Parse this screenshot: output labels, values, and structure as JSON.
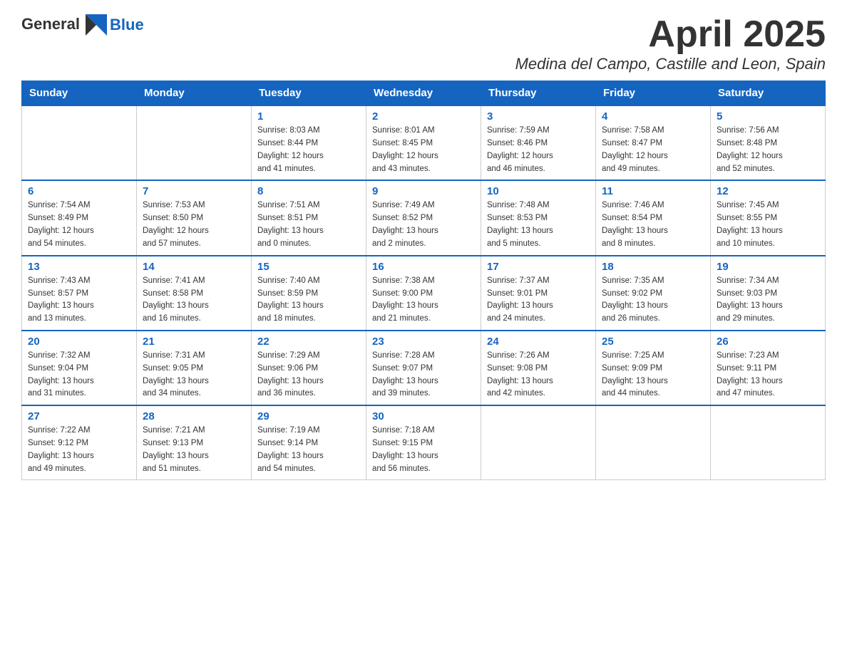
{
  "logo": {
    "text_general": "General",
    "text_blue": "Blue"
  },
  "header": {
    "month_year": "April 2025",
    "location": "Medina del Campo, Castille and Leon, Spain"
  },
  "weekdays": [
    "Sunday",
    "Monday",
    "Tuesday",
    "Wednesday",
    "Thursday",
    "Friday",
    "Saturday"
  ],
  "weeks": [
    [
      {
        "day": "",
        "info": ""
      },
      {
        "day": "",
        "info": ""
      },
      {
        "day": "1",
        "info": "Sunrise: 8:03 AM\nSunset: 8:44 PM\nDaylight: 12 hours\nand 41 minutes."
      },
      {
        "day": "2",
        "info": "Sunrise: 8:01 AM\nSunset: 8:45 PM\nDaylight: 12 hours\nand 43 minutes."
      },
      {
        "day": "3",
        "info": "Sunrise: 7:59 AM\nSunset: 8:46 PM\nDaylight: 12 hours\nand 46 minutes."
      },
      {
        "day": "4",
        "info": "Sunrise: 7:58 AM\nSunset: 8:47 PM\nDaylight: 12 hours\nand 49 minutes."
      },
      {
        "day": "5",
        "info": "Sunrise: 7:56 AM\nSunset: 8:48 PM\nDaylight: 12 hours\nand 52 minutes."
      }
    ],
    [
      {
        "day": "6",
        "info": "Sunrise: 7:54 AM\nSunset: 8:49 PM\nDaylight: 12 hours\nand 54 minutes."
      },
      {
        "day": "7",
        "info": "Sunrise: 7:53 AM\nSunset: 8:50 PM\nDaylight: 12 hours\nand 57 minutes."
      },
      {
        "day": "8",
        "info": "Sunrise: 7:51 AM\nSunset: 8:51 PM\nDaylight: 13 hours\nand 0 minutes."
      },
      {
        "day": "9",
        "info": "Sunrise: 7:49 AM\nSunset: 8:52 PM\nDaylight: 13 hours\nand 2 minutes."
      },
      {
        "day": "10",
        "info": "Sunrise: 7:48 AM\nSunset: 8:53 PM\nDaylight: 13 hours\nand 5 minutes."
      },
      {
        "day": "11",
        "info": "Sunrise: 7:46 AM\nSunset: 8:54 PM\nDaylight: 13 hours\nand 8 minutes."
      },
      {
        "day": "12",
        "info": "Sunrise: 7:45 AM\nSunset: 8:55 PM\nDaylight: 13 hours\nand 10 minutes."
      }
    ],
    [
      {
        "day": "13",
        "info": "Sunrise: 7:43 AM\nSunset: 8:57 PM\nDaylight: 13 hours\nand 13 minutes."
      },
      {
        "day": "14",
        "info": "Sunrise: 7:41 AM\nSunset: 8:58 PM\nDaylight: 13 hours\nand 16 minutes."
      },
      {
        "day": "15",
        "info": "Sunrise: 7:40 AM\nSunset: 8:59 PM\nDaylight: 13 hours\nand 18 minutes."
      },
      {
        "day": "16",
        "info": "Sunrise: 7:38 AM\nSunset: 9:00 PM\nDaylight: 13 hours\nand 21 minutes."
      },
      {
        "day": "17",
        "info": "Sunrise: 7:37 AM\nSunset: 9:01 PM\nDaylight: 13 hours\nand 24 minutes."
      },
      {
        "day": "18",
        "info": "Sunrise: 7:35 AM\nSunset: 9:02 PM\nDaylight: 13 hours\nand 26 minutes."
      },
      {
        "day": "19",
        "info": "Sunrise: 7:34 AM\nSunset: 9:03 PM\nDaylight: 13 hours\nand 29 minutes."
      }
    ],
    [
      {
        "day": "20",
        "info": "Sunrise: 7:32 AM\nSunset: 9:04 PM\nDaylight: 13 hours\nand 31 minutes."
      },
      {
        "day": "21",
        "info": "Sunrise: 7:31 AM\nSunset: 9:05 PM\nDaylight: 13 hours\nand 34 minutes."
      },
      {
        "day": "22",
        "info": "Sunrise: 7:29 AM\nSunset: 9:06 PM\nDaylight: 13 hours\nand 36 minutes."
      },
      {
        "day": "23",
        "info": "Sunrise: 7:28 AM\nSunset: 9:07 PM\nDaylight: 13 hours\nand 39 minutes."
      },
      {
        "day": "24",
        "info": "Sunrise: 7:26 AM\nSunset: 9:08 PM\nDaylight: 13 hours\nand 42 minutes."
      },
      {
        "day": "25",
        "info": "Sunrise: 7:25 AM\nSunset: 9:09 PM\nDaylight: 13 hours\nand 44 minutes."
      },
      {
        "day": "26",
        "info": "Sunrise: 7:23 AM\nSunset: 9:11 PM\nDaylight: 13 hours\nand 47 minutes."
      }
    ],
    [
      {
        "day": "27",
        "info": "Sunrise: 7:22 AM\nSunset: 9:12 PM\nDaylight: 13 hours\nand 49 minutes."
      },
      {
        "day": "28",
        "info": "Sunrise: 7:21 AM\nSunset: 9:13 PM\nDaylight: 13 hours\nand 51 minutes."
      },
      {
        "day": "29",
        "info": "Sunrise: 7:19 AM\nSunset: 9:14 PM\nDaylight: 13 hours\nand 54 minutes."
      },
      {
        "day": "30",
        "info": "Sunrise: 7:18 AM\nSunset: 9:15 PM\nDaylight: 13 hours\nand 56 minutes."
      },
      {
        "day": "",
        "info": ""
      },
      {
        "day": "",
        "info": ""
      },
      {
        "day": "",
        "info": ""
      }
    ]
  ]
}
